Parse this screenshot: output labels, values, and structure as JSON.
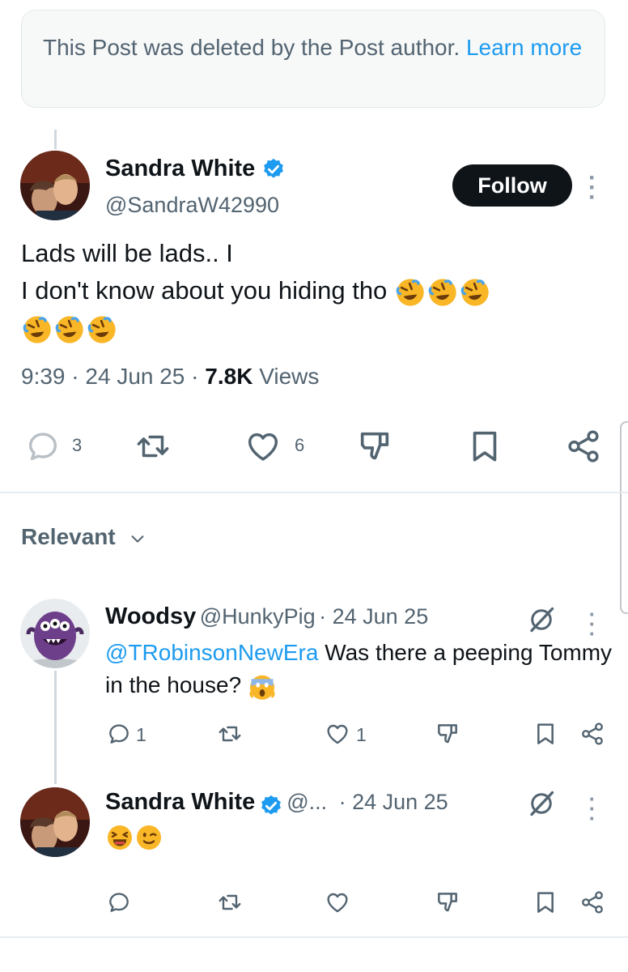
{
  "deleted_notice": {
    "text": "This Post was deleted by the Post author.",
    "link": "Learn more"
  },
  "main_post": {
    "author_name": "Sandra White",
    "author_handle": "@SandraW42990",
    "follow_label": "Follow",
    "text_line1": "Lads will be lads.. I",
    "text_line2": "I don't know about you hiding tho",
    "time": "9:39",
    "date": "24 Jun 25",
    "views_count": "7.8K",
    "views_label": "Views",
    "actions": {
      "replies": "3",
      "likes": "6"
    }
  },
  "relevant_label": "Relevant",
  "replies": [
    {
      "author_name": "Woodsy",
      "author_handle": "@HunkyPig",
      "date": "· 24 Jun 25",
      "mention": "@TRobinsonNewEra",
      "text": " Was there a peeping Tommy in the house?",
      "actions": {
        "replies": "1",
        "likes": "1"
      }
    },
    {
      "author_name": "Sandra White",
      "author_handle": "@...",
      "date": "· 24 Jun 25"
    }
  ],
  "colors": {
    "accent": "#1d9bf0",
    "text": "#0f1419",
    "muted": "#536471"
  },
  "icons": [
    "verified-badge-icon",
    "reply-icon",
    "repost-icon",
    "like-icon",
    "dislike-icon",
    "bookmark-icon",
    "share-icon",
    "grok-icon",
    "more-icon",
    "chevron-down-icon"
  ]
}
